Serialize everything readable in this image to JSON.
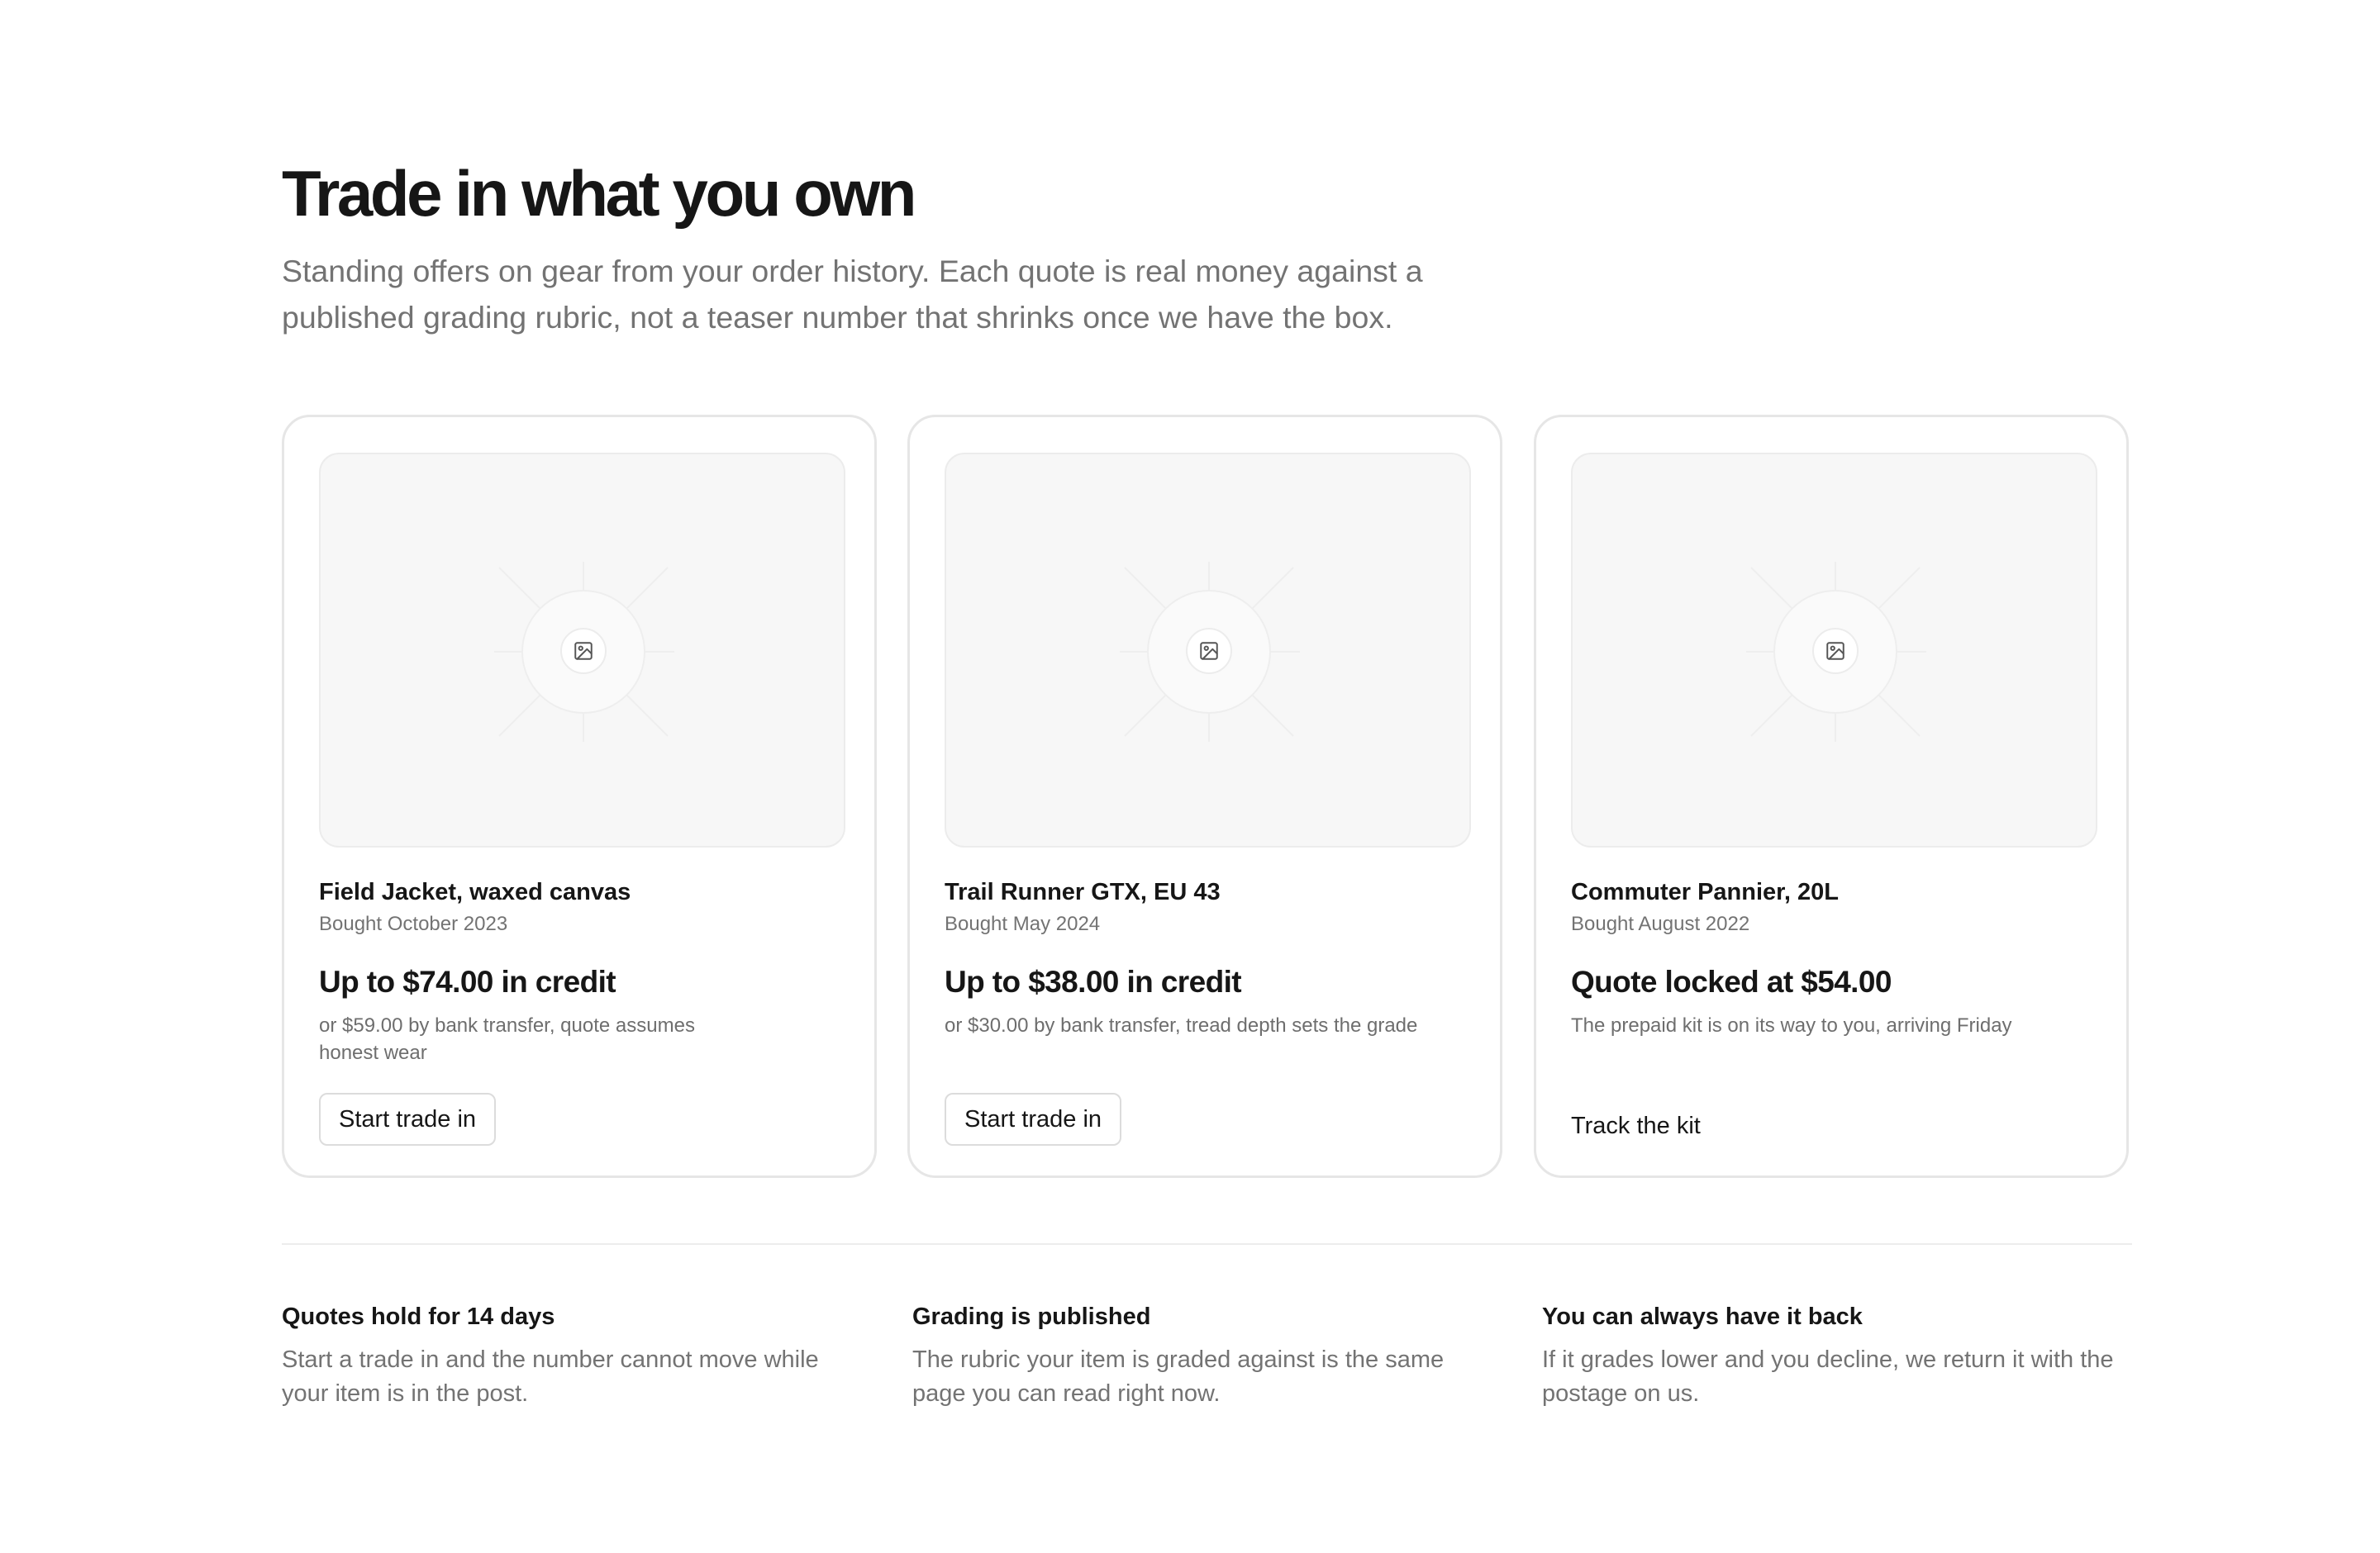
{
  "header": {
    "title": "Trade in what you own",
    "subtitle": "Standing offers on gear from your order history. Each quote is real money against a published grading rubric, not a teaser number that shrinks once we have the box."
  },
  "cards": [
    {
      "name": "Field Jacket, waxed canvas",
      "bought": "Bought October 2023",
      "offer": "Up to $74.00 in credit",
      "note": "or $59.00 by bank transfer, quote assumes honest wear",
      "action": "Start trade in",
      "image_icon": "image-icon"
    },
    {
      "name": "Trail Runner GTX, EU 43",
      "bought": "Bought May 2024",
      "offer": "Up to $38.00 in credit",
      "note": "or $30.00 by bank transfer, tread depth sets the grade",
      "action": "Start trade in",
      "image_icon": "image-icon"
    },
    {
      "name": "Commuter Pannier, 20L",
      "bought": "Bought August 2022",
      "offer": "Quote locked at $54.00",
      "note": "The prepaid kit is on its way to you, arriving Friday",
      "action": "Track the kit",
      "image_icon": "image-icon"
    }
  ],
  "features": [
    {
      "title": "Quotes hold for 14 days",
      "text": "Start a trade in and the number cannot move while your item is in the post."
    },
    {
      "title": "Grading is published",
      "text": "The rubric your item is graded against is the same page you can read right now."
    },
    {
      "title": "You can always have it back",
      "text": "If it grades lower and you decline, we return it with the postage on us."
    }
  ],
  "colors": {
    "text_primary": "#161616",
    "text_muted": "#737373",
    "card_border": "#e6e6e6",
    "media_bg": "#f7f7f7"
  }
}
